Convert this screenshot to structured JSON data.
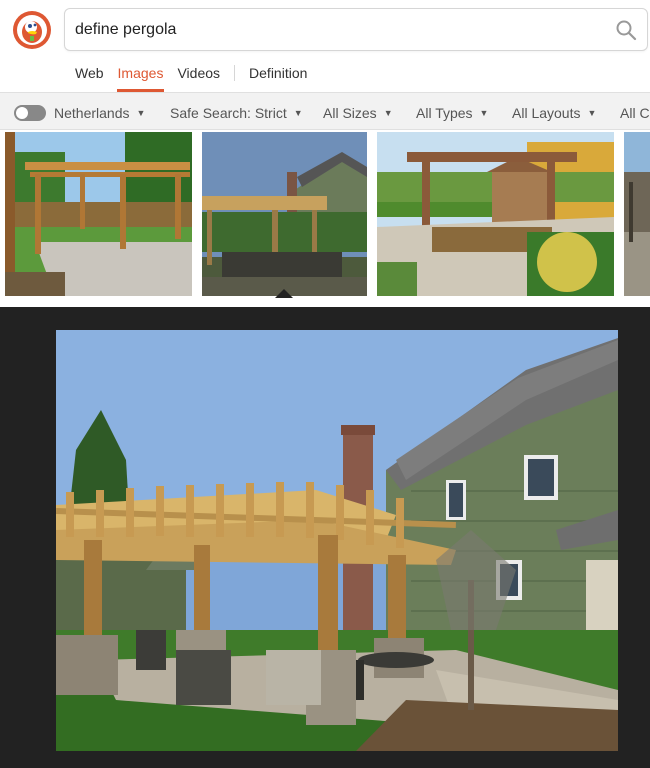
{
  "search": {
    "query": "define pergola"
  },
  "nav": {
    "web": "Web",
    "images": "Images",
    "videos": "Videos",
    "definition": "Definition"
  },
  "filters": {
    "region": "Netherlands",
    "safe_search": "Safe Search: Strict",
    "sizes": "All Sizes",
    "types": "All Types",
    "layouts": "All Layouts",
    "colors": "All Colors"
  },
  "colors": {
    "accent": "#de5833",
    "panel": "#222222",
    "filter_bar": "#f2f2f2"
  },
  "icons": {
    "logo": "duckduckgo-logo",
    "search": "magnifier-icon",
    "caret": "caret-down-icon"
  }
}
